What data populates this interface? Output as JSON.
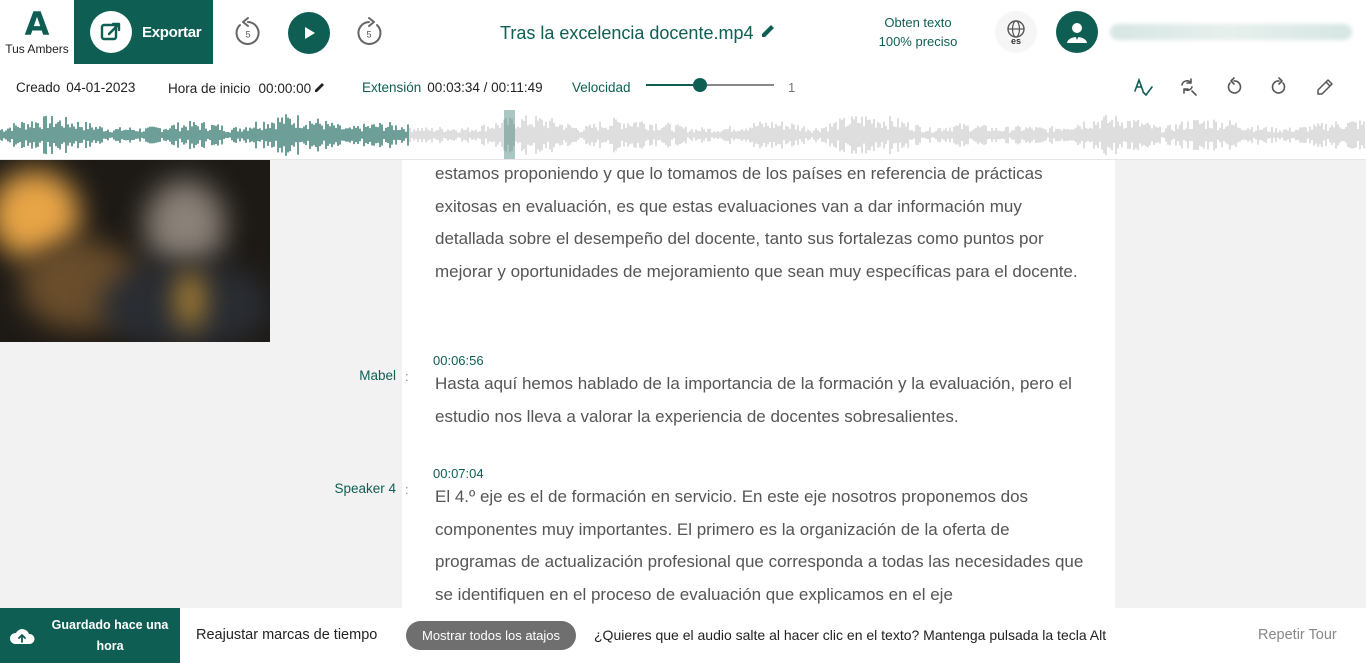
{
  "header": {
    "logo_glyph": "A",
    "logo_label": "Tus Ambers",
    "export_label": "Exportar",
    "rewind_seconds": "5",
    "forward_seconds": "5",
    "file_title": "Tras la excelencia docente.mp4",
    "promo_line1": "Obten texto",
    "promo_line2": "100% preciso",
    "language_code": "es"
  },
  "info": {
    "created_label": "Creado",
    "created_value": "04-01-2023",
    "start_label": "Hora de inicio",
    "start_value": "00:00:00",
    "extension_label": "Extensión",
    "extension_value": "00:03:34 / 00:11:49",
    "speed_label": "Velocidad",
    "speed_value": "1",
    "speed_level_fraction": 0.42
  },
  "waveform": {
    "played_fraction": 0.3,
    "played_color": "#0e5e53",
    "unplayed_color": "#c8c8c8"
  },
  "transcript": {
    "block0_text": "estamos proponiendo y que lo tomamos de los países en referencia de prácticas exitosas en evaluación, es que estas evaluaciones van a dar información muy detallada sobre el desempeño del docente, tanto sus fortalezas como puntos por mejorar y oportunidades de mejoramiento que sean muy específicas para el docente.",
    "block1_speaker": "Mabel",
    "block1_time": "00:06:56",
    "block1_text": "Hasta aquí hemos hablado de la importancia de la formación y la evaluación, pero el estudio nos lleva a valorar la experiencia de docentes sobresalientes.",
    "block2_speaker": "Speaker 4",
    "block2_time": "00:07:04",
    "block2_text": "El 4.º eje es el de formación en servicio. En este eje nosotros proponemos dos componentes muy importantes. El primero es la organización de la oferta de programas de actualización profesional que corresponda a todas las necesidades que se identifiquen en el proceso de evaluación que explicamos en el eje"
  },
  "footer": {
    "saved_line1": "Guardado hace una",
    "saved_line2": "hora",
    "readjust_label": "Reajustar marcas de tiempo",
    "shortcuts_label": "Mostrar todos los atajos",
    "hint_text": "¿Quieres que el audio salte al hacer clic en el texto? Mantenga pulsada la tecla Alt",
    "tour_label": "Repetir Tour"
  },
  "colors": {
    "brand": "#0e5e53",
    "text": "#555555"
  }
}
